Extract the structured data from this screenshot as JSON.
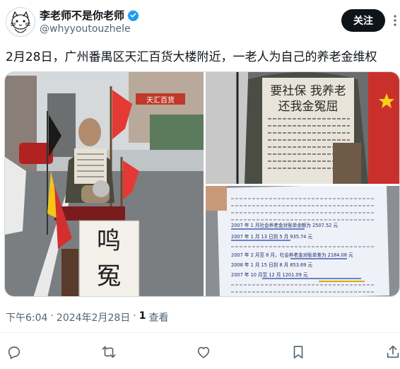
{
  "author": {
    "name": "李老师不是你老师",
    "handle": "@whyyoutouzhele",
    "verified": true,
    "avatar_icon": "sketch-cat-avatar"
  },
  "follow_label": "关注",
  "tweet_text": "2月28日，广州番禺区天汇百货大楼附近，一老人为自己的养老金维权",
  "images": {
    "photo1": {
      "shop_sign": "天汇百货",
      "banner_text": [
        "鸣",
        "冤"
      ]
    },
    "photo2": {
      "shirt_lines": [
        "要社保 我养老",
        "还我金冤屈"
      ]
    },
    "photo3": {
      "doc_lines": [
        "2007 年 1 月社会养老金对账单余额为 2507.52 元",
        "2007 年 1 月 13 日到 5 月 935.74 元",
        "2007 年 2 月至 8 月，社会养老金对账单差为 2184.08 元",
        "2008 年 1 月 15 日到 8 月 853.69 元",
        "2007 年 10 月至 12 月 1201.09 元"
      ]
    }
  },
  "meta": {
    "time": "下午6:04",
    "dot": "·",
    "date": "2024年2月28日",
    "views_count": "1",
    "views_label": "查看"
  },
  "actions": [
    "reply-icon",
    "retweet-icon",
    "like-icon",
    "bookmark-icon",
    "share-icon"
  ],
  "colors": {
    "accent": "#1d9bf0",
    "text": "#0f1419",
    "muted": "#536471",
    "button": "#0f1419"
  }
}
